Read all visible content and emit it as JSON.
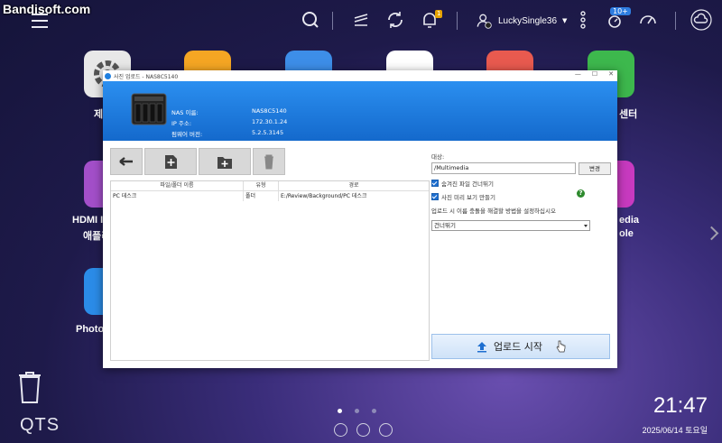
{
  "watermark": "Bandisoft.com",
  "topbar": {
    "notification_badge": "1",
    "username": "LuckySingle36",
    "update_badge": "10+"
  },
  "desktop": {
    "apps": [
      {
        "id": "settings",
        "label": "제",
        "color": "#e8e8e8"
      },
      {
        "id": "files",
        "label": "",
        "color": "#f5a623"
      },
      {
        "id": "storage",
        "label": "",
        "color": "#3d8ee8"
      },
      {
        "id": "backup",
        "label": "",
        "color": "#ffffff"
      },
      {
        "id": "appcenter",
        "label": "",
        "color": "#e85a4f"
      },
      {
        "id": "helpdesk",
        "label": "센터",
        "color": "#3db84d"
      },
      {
        "id": "hdmi",
        "label_line1": "HDMI I",
        "label_line2": "애플리",
        "color": "#a34fc9"
      },
      {
        "id": "media",
        "label_line1": "edia",
        "label_line2": "ole",
        "color": "#c83ac0"
      },
      {
        "id": "photo",
        "label": "Photo",
        "color": "#2b8ce8"
      }
    ],
    "qts_label": "QTS",
    "clock": "21:47",
    "date": "2025/06/14 토요일"
  },
  "dialog": {
    "title": "사진 업로드 - NAS8C5140",
    "nas_info": [
      {
        "label": "NAS 이름:",
        "value": "NAS8C5140"
      },
      {
        "label": "IP 주소:",
        "value": "172.30.1.24"
      },
      {
        "label": "펌웨어 버전:",
        "value": "5.2.5.3145"
      }
    ],
    "columns": [
      "파일/폴더 이름",
      "유형",
      "경로"
    ],
    "rows": [
      {
        "name": "PC 데스크",
        "type": "폴더",
        "path": "E:/Review/Background/PC 데스크"
      }
    ],
    "dest_label": "대상:",
    "dest_value": "/Multimedia",
    "change_button": "변경",
    "option_hidden": "숨겨진 파일 건너뛰기",
    "option_thumb": "사진 미리 보기 만들기",
    "conflict_label": "업로드 시 이름 충돌을 해결할 방법을 설정하십시오",
    "conflict_value": "건너뛰기",
    "upload_button": "업로드 시작"
  }
}
